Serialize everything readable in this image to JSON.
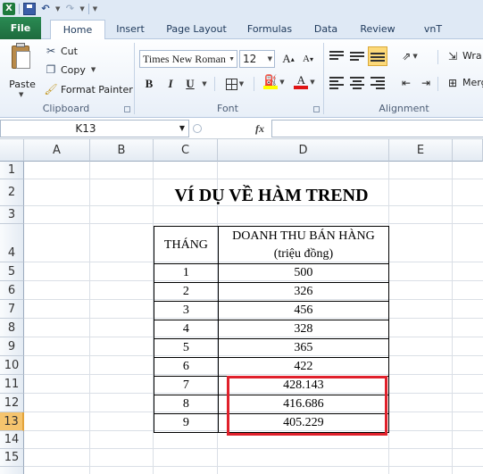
{
  "ribbon": {
    "tabs": [
      "File",
      "Home",
      "Insert",
      "Page Layout",
      "Formulas",
      "Data",
      "Review",
      "vnT"
    ],
    "clipboard": {
      "paste": "Paste",
      "cut": "Cut",
      "copy": "Copy",
      "format_painter": "Format Painter",
      "group_label": "Clipboard"
    },
    "font": {
      "name": "Times New Roman",
      "size": "12",
      "bold": "B",
      "italic": "I",
      "underline": "U",
      "group_label": "Font"
    },
    "alignment": {
      "wrap": "Wra",
      "merge": "Merg",
      "group_label": "Alignment"
    }
  },
  "formula_bar": {
    "name_box": "K13",
    "fx": "fx",
    "value": ""
  },
  "grid": {
    "columns": [
      "A",
      "B",
      "C",
      "D",
      "E"
    ],
    "rows": [
      "1",
      "2",
      "3",
      "4",
      "5",
      "6",
      "7",
      "8",
      "9",
      "10",
      "11",
      "12",
      "13",
      "14",
      "15"
    ],
    "selected_row": "13"
  },
  "sheet": {
    "title": "VÍ DỤ VỀ HÀM TREND",
    "table": {
      "headers": {
        "month": "THÁNG",
        "revenue_line1": "DOANH THU BÁN HÀNG",
        "revenue_line2": "(triệu đồng)"
      },
      "rows": [
        {
          "month": "1",
          "revenue": "500"
        },
        {
          "month": "2",
          "revenue": "326"
        },
        {
          "month": "3",
          "revenue": "456"
        },
        {
          "month": "4",
          "revenue": "328"
        },
        {
          "month": "5",
          "revenue": "365"
        },
        {
          "month": "6",
          "revenue": "422"
        },
        {
          "month": "7",
          "revenue": "428.143"
        },
        {
          "month": "8",
          "revenue": "416.686"
        },
        {
          "month": "9",
          "revenue": "405.229"
        }
      ]
    }
  },
  "colors": {
    "file_tab": "#217346",
    "highlight": "#e0202b",
    "selected_row": "#f5c46e"
  }
}
